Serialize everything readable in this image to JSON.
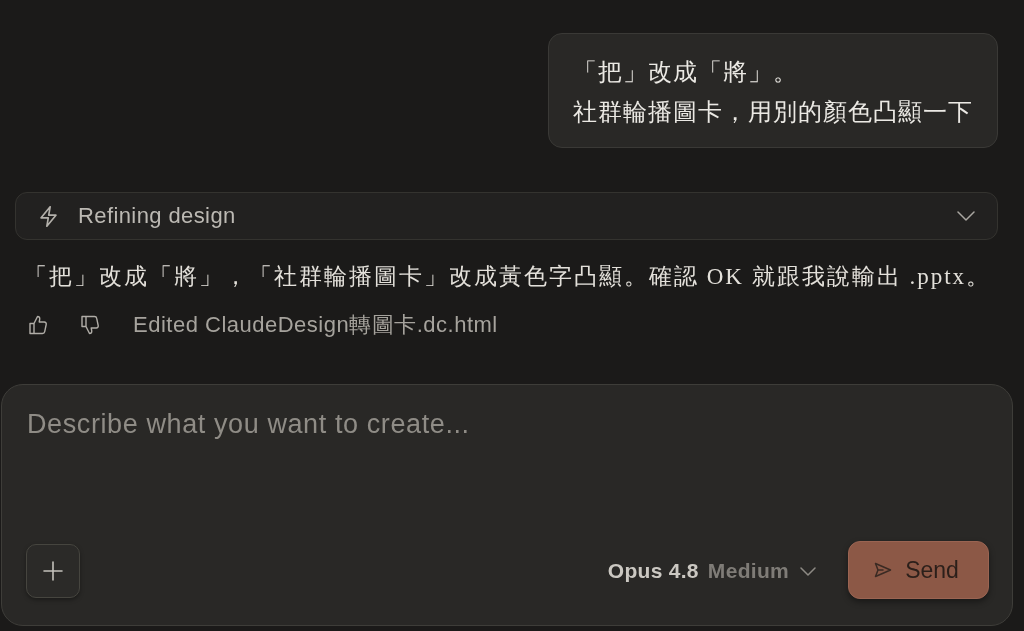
{
  "user_message": {
    "lines": [
      "「把」改成「將」。",
      "社群輪播圖卡，用別的顏色凸顯一下"
    ]
  },
  "status": {
    "label": "Refining design"
  },
  "response": {
    "text": "「把」改成「將」，「社群輪播圖卡」改成黃色字凸顯。確認 OK 就跟我說輸出 .pptx。",
    "edit_note": "Edited ClaudeDesign轉圖卡.dc.html"
  },
  "composer": {
    "placeholder": "Describe what you want to create...",
    "model": "Opus 4.8",
    "effort": "Medium",
    "send_label": "Send"
  }
}
